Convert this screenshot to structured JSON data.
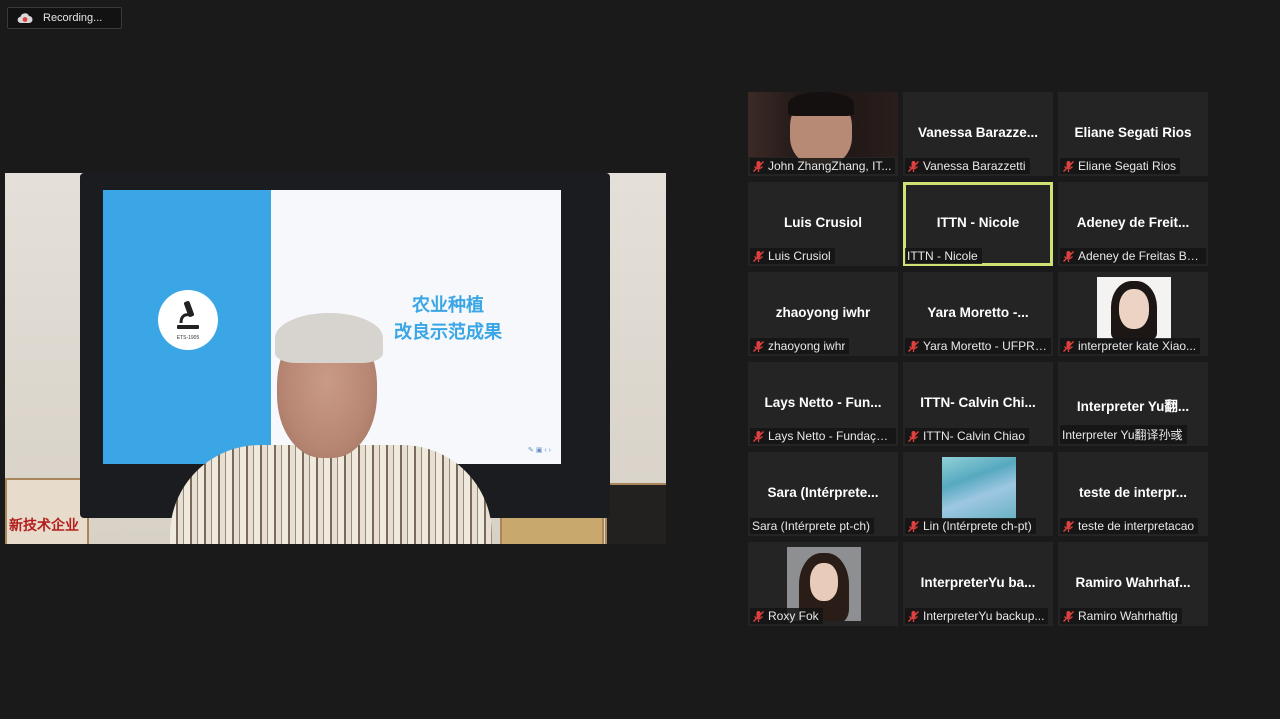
{
  "recording": {
    "label": "Recording...",
    "icon": "cloud-record-icon"
  },
  "speaker": {
    "slide_title_line1": "农业种植",
    "slide_title_line2": "改良示范成果",
    "logo_text": "ETS-1905",
    "plaque_text": "新技术企业"
  },
  "tiles": [
    {
      "name": "",
      "label": "John ZhangZhang, IT...",
      "muted": true,
      "photo": "john"
    },
    {
      "name": "Vanessa  Barazze...",
      "label": "Vanessa Barazzetti",
      "muted": true
    },
    {
      "name": "Eliane Segati Rios",
      "label": "Eliane Segati Rios",
      "muted": true
    },
    {
      "name": "Luis Crusiol",
      "label": "Luis Crusiol",
      "muted": true
    },
    {
      "name": "ITTN - Nicole",
      "label": "ITTN - Nicole",
      "muted": false,
      "active": true
    },
    {
      "name": "Adeney  de  Freit...",
      "label": "Adeney de Freitas Bu...",
      "muted": true
    },
    {
      "name": "zhaoyong  iwhr",
      "label": "zhaoyong  iwhr",
      "muted": true
    },
    {
      "name": "Yara Moretto  -...",
      "label": "Yara Moretto - UFPR/...",
      "muted": true
    },
    {
      "name": "",
      "label": "interpreter kate Xiao...",
      "muted": true,
      "photo": "kate"
    },
    {
      "name": "Lays Netto - Fun...",
      "label": "Lays Netto - Fundaçã...",
      "muted": true
    },
    {
      "name": "ITTN-  Calvin  Chi...",
      "label": "ITTN- Calvin Chiao",
      "muted": true
    },
    {
      "name": "Interpreter  Yu翻...",
      "label": "Interpreter Yu翻译孙彧",
      "muted": false
    },
    {
      "name": "Sara  (Intérprete...",
      "label": "Sara (Intérprete pt-ch)",
      "muted": false
    },
    {
      "name": "",
      "label": "Lin (Intérprete ch-pt)",
      "muted": true,
      "photo": "lin"
    },
    {
      "name": "teste  de  interpr...",
      "label": "teste de interpretacao",
      "muted": true
    },
    {
      "name": "",
      "label": "Roxy Fok",
      "muted": true,
      "photo": "roxy"
    },
    {
      "name": "InterpreterYu  ba...",
      "label": "InterpreterYu backup...",
      "muted": true
    },
    {
      "name": "Ramiro  Wahrhaf...",
      "label": "Ramiro Wahrhaftig",
      "muted": true
    }
  ],
  "colors": {
    "background": "#1a1a1a",
    "tile": "#242424",
    "active_border": "#cfe275",
    "mute_red": "#e0413f"
  }
}
